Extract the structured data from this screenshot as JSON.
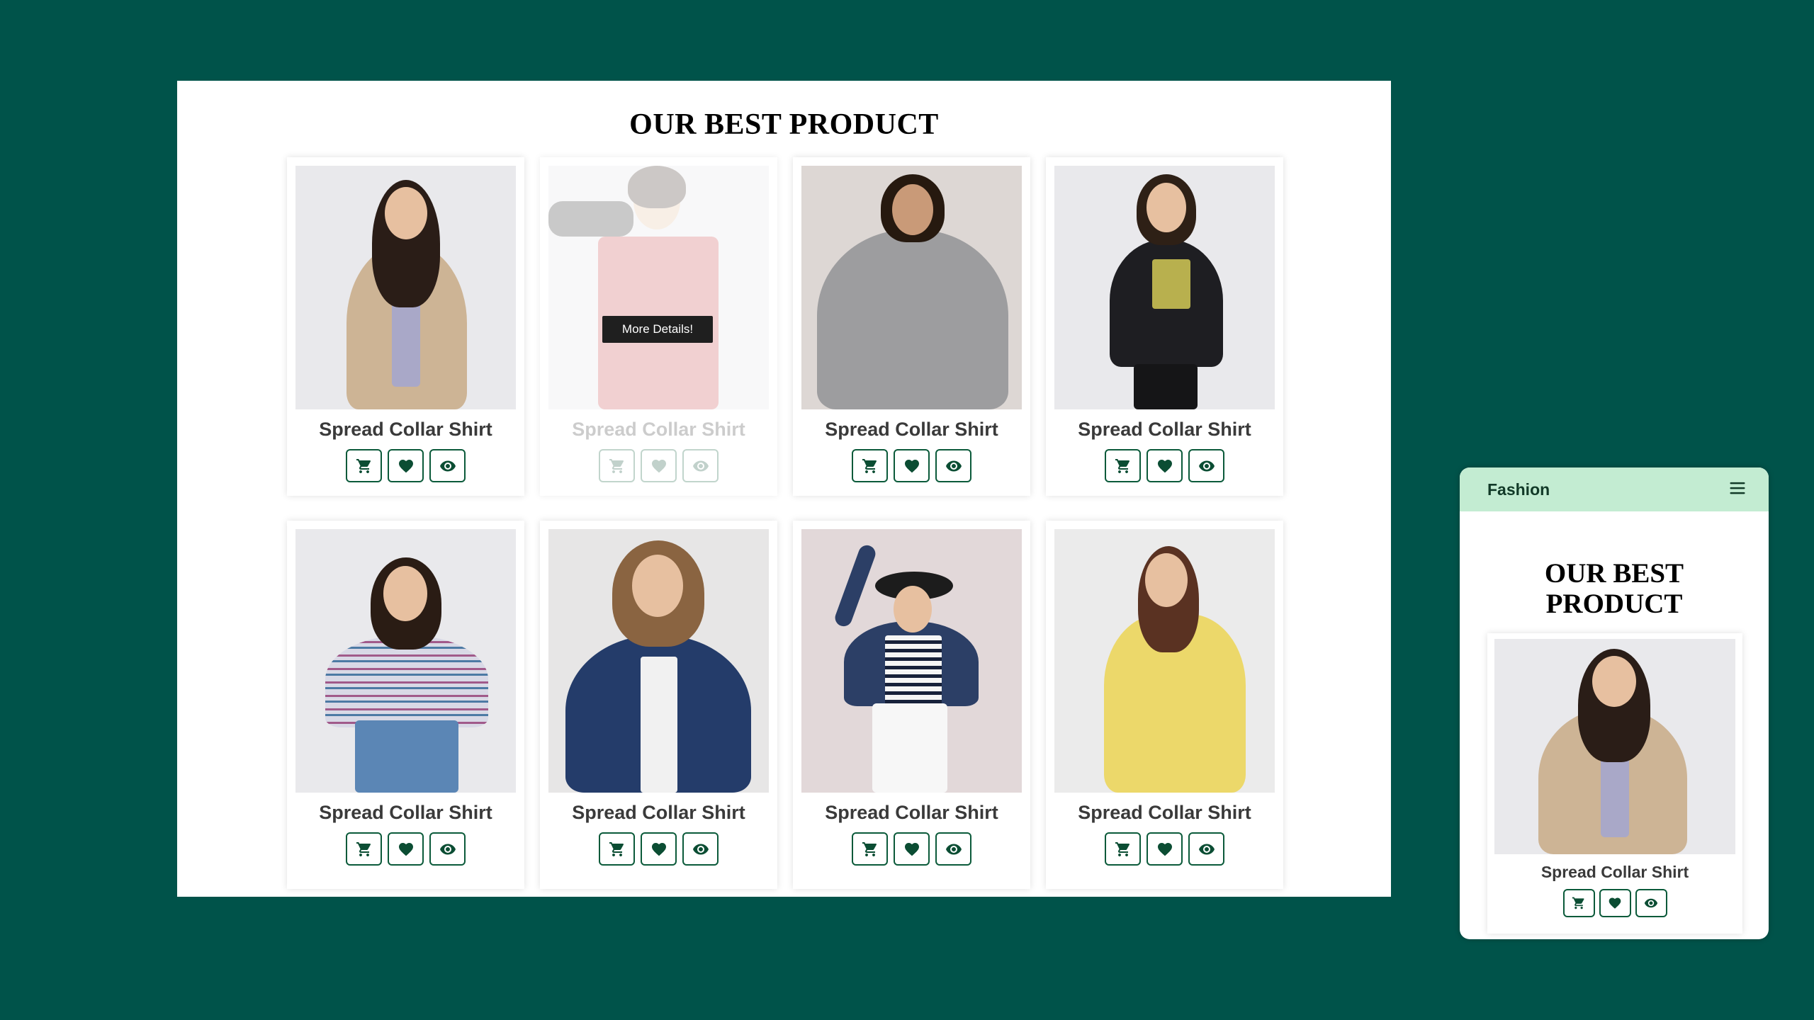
{
  "desktop": {
    "heading": "OUR BEST PRODUCT",
    "tooltip": "More Details!",
    "products": [
      {
        "title": "Spread Collar Shirt",
        "image": "woman-teddy-jacket"
      },
      {
        "title": "Spread Collar Shirt",
        "image": "woman-plaid-shirt-hanger"
      },
      {
        "title": "Spread Collar Shirt",
        "image": "woman-grey-hoodie"
      },
      {
        "title": "Spread Collar Shirt",
        "image": "woman-black-sweatshirt"
      },
      {
        "title": "Spread Collar Shirt",
        "image": "woman-striped-tee"
      },
      {
        "title": "Spread Collar Shirt",
        "image": "woman-denim-jacket"
      },
      {
        "title": "Spread Collar Shirt",
        "image": "woman-hat-denim-jacket"
      },
      {
        "title": "Spread Collar Shirt",
        "image": "woman-yellow-floral-dress"
      }
    ]
  },
  "mobile": {
    "brand": "Fashion",
    "heading_line1": "OUR BEST",
    "heading_line2": "PRODUCT",
    "product": {
      "title": "Spread Collar Shirt",
      "image": "woman-teddy-jacket"
    }
  },
  "icons": {
    "cart": "cart-icon",
    "heart": "heart-icon",
    "eye": "eye-icon",
    "menu": "hamburger-menu-icon"
  },
  "colors": {
    "background": "#00534a",
    "button_border": "#0b5a3a",
    "mobile_header": "#c3ecd2"
  }
}
